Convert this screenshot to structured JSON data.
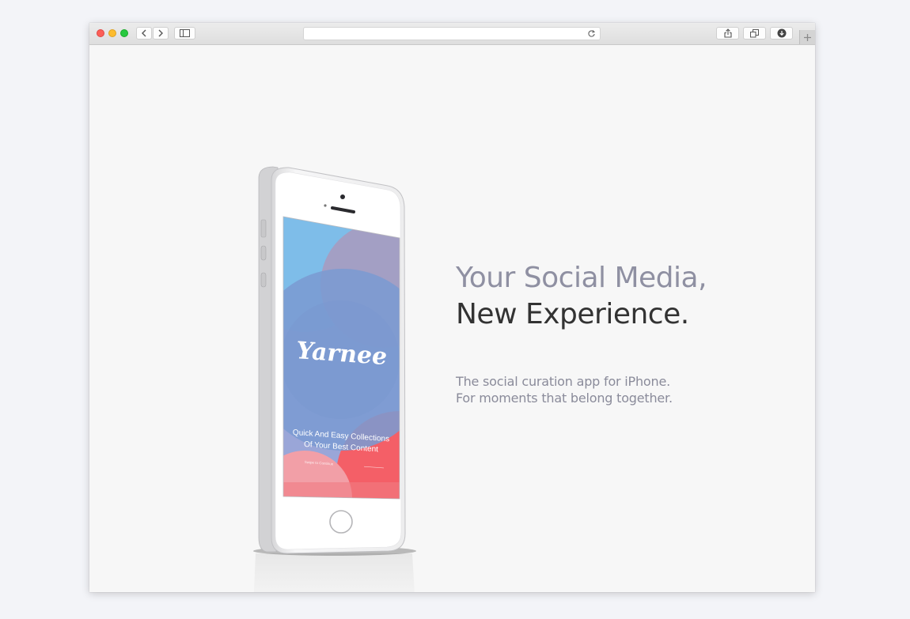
{
  "browser": {
    "url": "",
    "icons": {
      "back": "chevron-left-icon",
      "forward": "chevron-right-icon",
      "sidebar": "sidebar-icon",
      "reload": "reload-icon",
      "share": "share-icon",
      "tabs": "tabs-overview-icon",
      "downloads": "download-icon",
      "new_tab": "plus-icon"
    }
  },
  "hero": {
    "headline_line1": "Your Social Media,",
    "headline_line2": "New Experience.",
    "tagline_line1": "The social curation app for iPhone.",
    "tagline_line2": "For moments that belong together."
  },
  "phone_screen": {
    "app_name": "Yarnee",
    "caption_line1": "Quick And Easy Collections",
    "caption_line2": "Of Your Best Content",
    "hint": "Swipe to Continue"
  },
  "colors": {
    "page_bg": "#f7f7f7",
    "headline_light": "#8f90a2",
    "headline_dark": "#333333",
    "screen_blue": "#7ea3d6",
    "screen_red": "#f2686e"
  }
}
